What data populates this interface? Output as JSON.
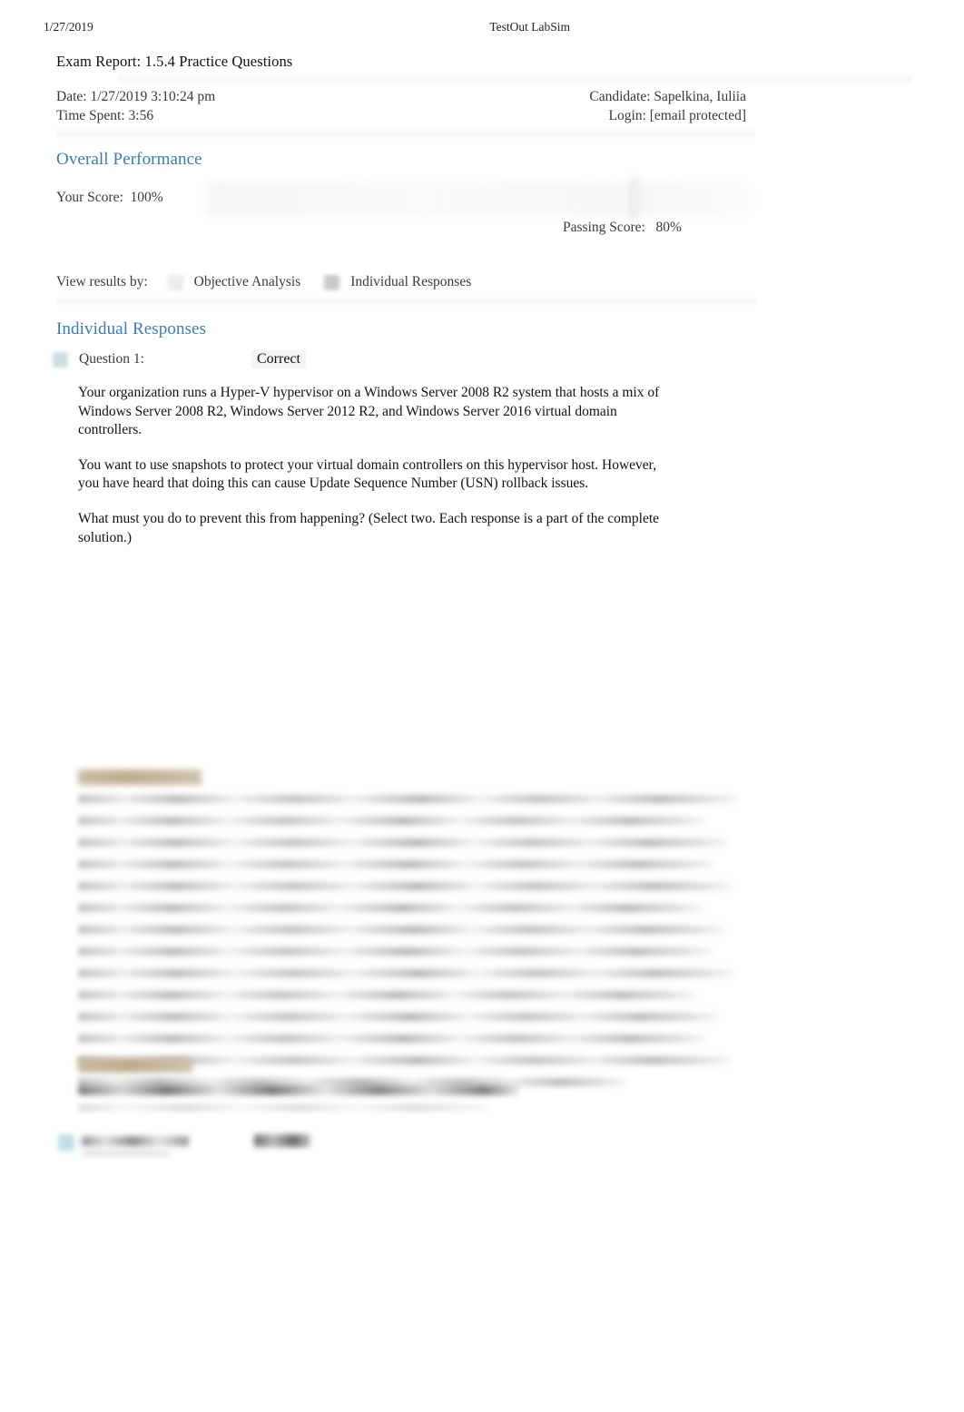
{
  "print_header": {
    "date": "1/27/2019",
    "app_name": "TestOut LabSim"
  },
  "report": {
    "title": "Exam Report: 1.5.4 Practice Questions",
    "date_label": "Date: 1/27/2019 3:10:24 pm",
    "time_spent_label": "Time Spent: 3:56",
    "candidate_label": "Candidate: Sapelkina, Iuliia",
    "login_label": "Login: [email protected]"
  },
  "overall_performance": {
    "heading": "Overall Performance",
    "your_score_label": "Your Score:",
    "your_score_value": "100%",
    "passing_score_label": "Passing Score:",
    "passing_score_value": "80%",
    "accent_color": "#3b7cb8"
  },
  "view_results": {
    "label": "View results by:",
    "options": [
      {
        "label": "Objective Analysis",
        "selected": false
      },
      {
        "label": "Individual Responses",
        "selected": true
      }
    ]
  },
  "individual_responses": {
    "heading": "Individual Responses",
    "questions": [
      {
        "number_label": "Question 1:",
        "status": "Correct",
        "paragraphs": [
          "Your organization runs a Hyper-V hypervisor on a Windows Server 2008 R2 system that hosts a mix of Windows Server 2008 R2, Windows Server 2012 R2, and Windows Server 2016 virtual domain controllers.",
          "You want to use snapshots to protect your virtual domain controllers on this hypervisor host. However, you have heard that doing this can cause Update Sequence Number (USN) rollback issues.",
          "What must you do to prevent this from happening? (Select two. Each response is a part of the complete solution.)"
        ]
      }
    ]
  },
  "explanation": {
    "heading_redacted": "",
    "body_redacted": "",
    "line_count": 14
  },
  "references": {
    "heading_redacted": "",
    "body_redacted": "",
    "line_count": 2
  },
  "footer_question": {
    "label_redacted": "",
    "status_redacted": ""
  }
}
